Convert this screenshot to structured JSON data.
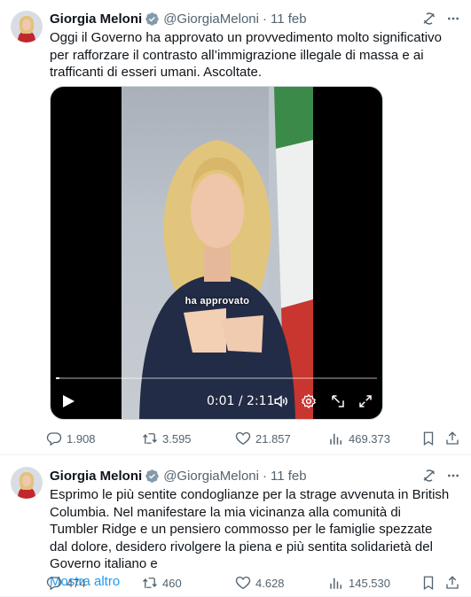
{
  "colors": {
    "accent": "#1d9bf0",
    "text": "#0f1419",
    "secondary": "#536471"
  },
  "tweets": [
    {
      "author": {
        "name": "Giorgia Meloni",
        "handle": "@GiorgiaMeloni",
        "verified": true
      },
      "dot": "·",
      "date": "11 feb",
      "text": "Oggi il Governo ha approvato un provvedimento molto significativo per rafforzare il contrasto all’immigrazione illegale di massa e ai trafficanti di esseri umani. Ascoltate.",
      "media": {
        "type": "video",
        "caption": "ha approvato",
        "timecode": "0:01 / 2:11",
        "progress": 0.01
      },
      "stats": {
        "replies": "1.908",
        "reposts": "3.595",
        "likes": "21.857",
        "views": "469.373"
      }
    },
    {
      "author": {
        "name": "Giorgia Meloni",
        "handle": "@GiorgiaMeloni",
        "verified": true
      },
      "dot": "·",
      "date": "11 feb",
      "text": "Esprimo le più sentite condoglianze per la strage avvenuta in British Columbia. Nel manifestare la mia vicinanza alla comunità di Tumbler Ridge e un pensiero commosso per le famiglie spezzate dal dolore, desidero rivolgere la piena e più sentita solidarietà del Governo italiano e",
      "show_more": "Mostra altro",
      "stats": {
        "replies": "474",
        "reposts": "460",
        "likes": "4.628",
        "views": "145.530"
      }
    }
  ]
}
